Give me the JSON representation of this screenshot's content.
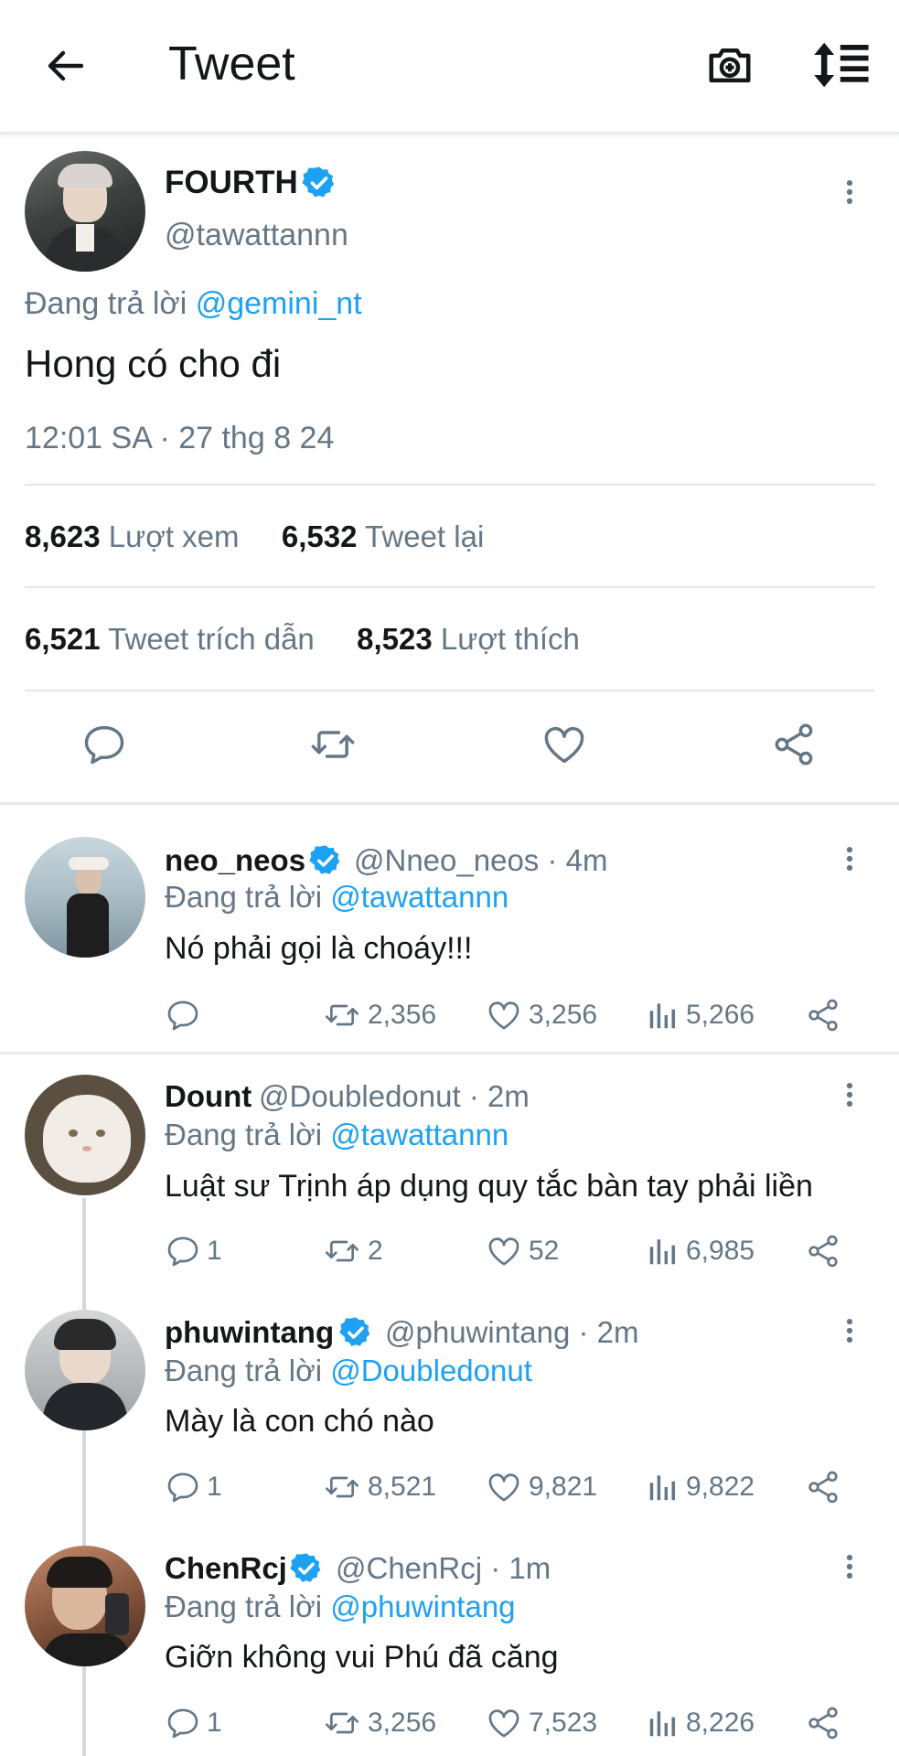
{
  "header": {
    "title": "Tweet"
  },
  "main_tweet": {
    "display_name": "FOURTH",
    "handle": "@tawattannn",
    "replying_prefix": "Đang trả lời",
    "replying_to": "@gemini_nt",
    "text": "Hong có cho đi",
    "timestamp": "12:01 SA · 27 thg 8 24",
    "stats": {
      "views_count": "8,623",
      "views_label": "Lượt xem",
      "retweets_count": "6,532",
      "retweets_label": "Tweet lại",
      "quotes_count": "6,521",
      "quotes_label": "Tweet trích dẫn",
      "likes_count": "8,523",
      "likes_label": "Lượt thích"
    }
  },
  "replies": [
    {
      "display_name": "neo_neos",
      "verified": true,
      "handle": "@Nneo_neos",
      "time": "· 4m",
      "replying_prefix": "Đang trả lời",
      "replying_to": "@tawattannn",
      "text": "Nó phải gọi là choáy!!!",
      "replies": "",
      "retweets": "2,356",
      "likes": "3,256",
      "views": "5,266"
    },
    {
      "display_name": "Dount",
      "verified": false,
      "handle": "@Doubledonut",
      "time": "· 2m",
      "replying_prefix": "Đang trả lời",
      "replying_to": "@tawattannn",
      "text": "Luật sư Trịnh áp dụng quy tắc bàn tay phải liền",
      "replies": "1",
      "retweets": "2",
      "likes": "52",
      "views": "6,985"
    },
    {
      "display_name": "phuwintang",
      "verified": true,
      "handle": "@phuwintang",
      "time": "· 2m",
      "replying_prefix": "Đang trả lời",
      "replying_to": "@Doubledonut",
      "text": "Mày là con chó nào",
      "replies": "1",
      "retweets": "8,521",
      "likes": "9,821",
      "views": "9,822"
    },
    {
      "display_name": "ChenRcj",
      "verified": true,
      "handle": "@ChenRcj",
      "time": "· 1m",
      "replying_prefix": "Đang trả lời",
      "replying_to": "@phuwintang",
      "text": "Giỡn không vui Phú đã căng",
      "replies": "1",
      "retweets": "3,256",
      "likes": "7,523",
      "views": "8,226"
    }
  ],
  "colors": {
    "accent": "#1da1f2",
    "muted": "#657786",
    "divider": "#e1e8ed"
  },
  "icons": [
    "back-arrow-icon",
    "camera-add-icon",
    "sort-icon",
    "verified-icon",
    "more-vertical-icon",
    "reply-icon",
    "retweet-icon",
    "like-icon",
    "share-icon",
    "views-icon"
  ]
}
